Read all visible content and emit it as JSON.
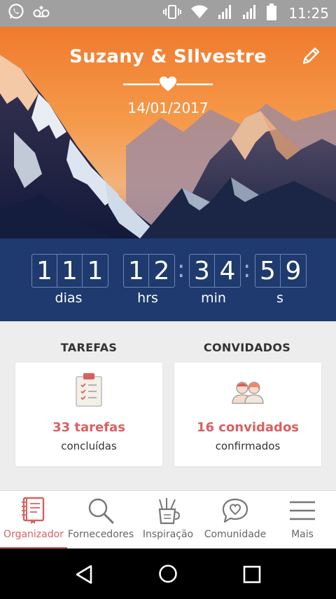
{
  "status_bar": {
    "time": "11:25",
    "left_icons": [
      "whatsapp-icon",
      "voicemail-icon"
    ],
    "right_icons": [
      "vibrate-icon",
      "wifi-icon",
      "signal-icon",
      "signal-icon",
      "battery-icon"
    ]
  },
  "hero": {
    "couple": "Suzany & SIlvestre",
    "date": "14/01/2017"
  },
  "countdown": {
    "days_digits": [
      "1",
      "1",
      "1"
    ],
    "hours_digits": [
      "1",
      "2"
    ],
    "minutes_digits": [
      "3",
      "4"
    ],
    "seconds_digits": [
      "5",
      "9"
    ],
    "labels": {
      "days": "dias",
      "hours": "hrs",
      "minutes": "min",
      "seconds": "s"
    }
  },
  "tasks": {
    "title": "TAREFAS",
    "count": "33 tarefas",
    "sub": "concluídas"
  },
  "guests": {
    "title": "CONVIDADOS",
    "count": "16 convidados",
    "sub": "confirmados"
  },
  "nav": {
    "items": [
      {
        "label": "Organizador",
        "icon": "notebook-icon",
        "active": true
      },
      {
        "label": "Fornecedores",
        "icon": "search-icon",
        "active": false
      },
      {
        "label": "Inspiração",
        "icon": "pencil-cup-icon",
        "active": false
      },
      {
        "label": "Comunidade",
        "icon": "heart-chat-icon",
        "active": false
      },
      {
        "label": "Mais",
        "icon": "menu-icon",
        "active": false
      }
    ]
  },
  "colors": {
    "accent": "#d96060",
    "countdown_bg": "#1e3a6e",
    "status_bar": "#a0a0a0"
  }
}
